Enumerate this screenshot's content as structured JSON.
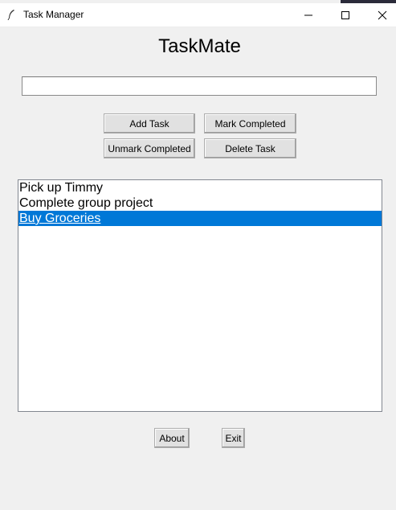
{
  "window": {
    "title": "Task Manager",
    "icon": "feather-icon",
    "controls": [
      "minimize-icon",
      "maximize-icon",
      "close-icon"
    ]
  },
  "app": {
    "heading": "TaskMate"
  },
  "task_input": {
    "value": "",
    "placeholder": ""
  },
  "buttons": {
    "add_task": "Add Task",
    "mark_completed": "Mark Completed",
    "unmark_completed": "Unmark Completed",
    "delete_task": "Delete Task",
    "about": "About",
    "exit": "Exit"
  },
  "tasks": [
    {
      "text": "Pick up Timmy",
      "selected": false
    },
    {
      "text": "Complete group project",
      "selected": false
    },
    {
      "text": "Buy Groceries",
      "selected": true
    }
  ],
  "colors": {
    "selection": "#0078d7",
    "background": "#f0f0f0"
  }
}
